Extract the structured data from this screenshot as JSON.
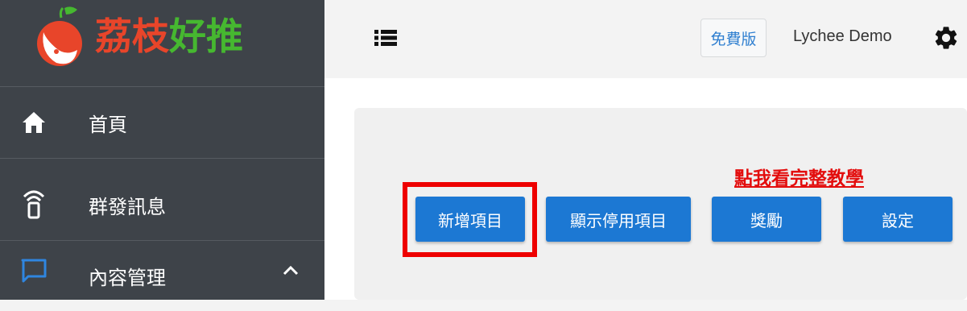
{
  "brand": {
    "name_part1": "荔枝",
    "name_part2": "好推",
    "logo_icon": "lychee-logo-icon"
  },
  "sidebar": {
    "items": [
      {
        "label": "首頁",
        "icon": "home-icon"
      },
      {
        "label": "群發訊息",
        "icon": "broadcast-icon"
      },
      {
        "label": "內容管理",
        "icon": "chat-bubble-icon",
        "expanded": true
      }
    ]
  },
  "header": {
    "menu_icon": "list-icon",
    "plan_badge": "免費版",
    "user_name": "Lychee Demo",
    "settings_icon": "gear-icon"
  },
  "main": {
    "tutorial_link": "點我看完整教學",
    "buttons": [
      {
        "label": "新增項目",
        "highlighted": true
      },
      {
        "label": "顯示停用項目"
      },
      {
        "label": "獎勵"
      },
      {
        "label": "設定"
      }
    ]
  },
  "colors": {
    "sidebar_bg": "#3e4349",
    "primary_button": "#1c78d3",
    "brand_red": "#e8452a",
    "brand_green": "#46b830",
    "highlight_red": "#ee0000",
    "tutorial_red": "#e30d0d",
    "chat_icon_blue": "#2f86e0"
  }
}
